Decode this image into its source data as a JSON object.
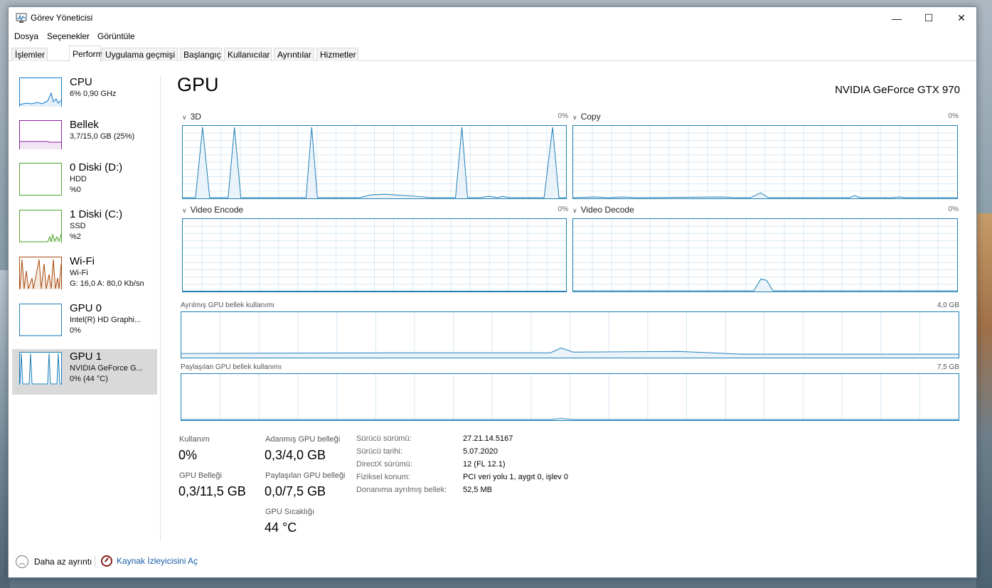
{
  "window": {
    "title": "Görev Yöneticisi",
    "controls": {
      "minimize": "—",
      "maximize": "☐",
      "close": "✕"
    }
  },
  "menu": [
    "Dosya",
    "Seçenekler",
    "Görüntüle"
  ],
  "tabs": [
    "İşlemler",
    "Performans",
    "Uygulama geçmişi",
    "Başlangıç",
    "Kullanıcılar",
    "Ayrıntılar",
    "Hizmetler"
  ],
  "active_tab": "Performans",
  "sidebar": {
    "items": [
      {
        "title": "CPU",
        "line1": "6%  0,90 GHz",
        "line2": "",
        "color": "#1178c8",
        "selected": false
      },
      {
        "title": "Bellek",
        "line1": "3,7/15,0 GB (25%)",
        "line2": "",
        "color": "#8b1fa0",
        "selected": false
      },
      {
        "title": "0 Diski (D:)",
        "line1": "HDD",
        "line2": "%0",
        "color": "#4da62f",
        "selected": false
      },
      {
        "title": "1 Diski (C:)",
        "line1": "SSD",
        "line2": "%2",
        "color": "#4da62f",
        "selected": false
      },
      {
        "title": "Wi-Fi",
        "line1": "Wi-Fi",
        "line2": "G:  16,0  A:  80,0 Kb/sn",
        "color": "#a7490e",
        "selected": false
      },
      {
        "title": "GPU 0",
        "line1": "Intel(R) HD Graphi...",
        "line2": "0%",
        "color": "#1f7fb6",
        "selected": false
      },
      {
        "title": "GPU 1",
        "line1": "NVIDIA GeForce G...",
        "line2": "0%  (44 °C)",
        "color": "#1f7fb6",
        "selected": true
      }
    ]
  },
  "main": {
    "title": "GPU",
    "model": "NVIDIA GeForce GTX 970",
    "engines": [
      {
        "name": "3D",
        "pct": "0%"
      },
      {
        "name": "Copy",
        "pct": "0%"
      },
      {
        "name": "Video Encode",
        "pct": "0%"
      },
      {
        "name": "Video Decode",
        "pct": "0%"
      }
    ],
    "dedicated_label": "Ayrılmış GPU bellek kullanımı",
    "dedicated_max": "4,0 GB",
    "shared_label": "Paylaşılan GPU bellek kullanımı",
    "shared_max": "7,5 GB"
  },
  "stats": {
    "usage_label": "Kullanım",
    "usage_value": "0%",
    "gpu_mem_label": "GPU Belleği",
    "gpu_mem_value": "0,3/11,5 GB",
    "dedicated_label": "Adanmış GPU belleği",
    "dedicated_value": "0,3/4,0 GB",
    "shared_label": "Paylaşılan GPU belleği",
    "shared_value": "0,0/7,5 GB",
    "temp_label": "GPU Sıcaklığı",
    "temp_value": "44 °C"
  },
  "info": [
    {
      "label": "Sürücü sürümü:",
      "value": "27.21.14.5167"
    },
    {
      "label": "Sürücü tarihi:",
      "value": "5.07.2020"
    },
    {
      "label": "DirectX sürümü:",
      "value": "12 (FL 12.1)"
    },
    {
      "label": "Fiziksel konum:",
      "value": "PCI veri yolu 1, aygıt 0, işlev 0"
    },
    {
      "label": "Donanıma ayrılmış bellek:",
      "value": "52,5 MB"
    }
  ],
  "footer": {
    "fewer_details": "Daha az ayrıntı",
    "resource_monitor": "Kaynak İzleyicisini Aç"
  },
  "colors": {
    "gpu_line": "#1f7fb6",
    "gpu_fill": "#eaf3fa",
    "grid": "#d8e8f3",
    "selected_bg": "#d9d9d9"
  }
}
